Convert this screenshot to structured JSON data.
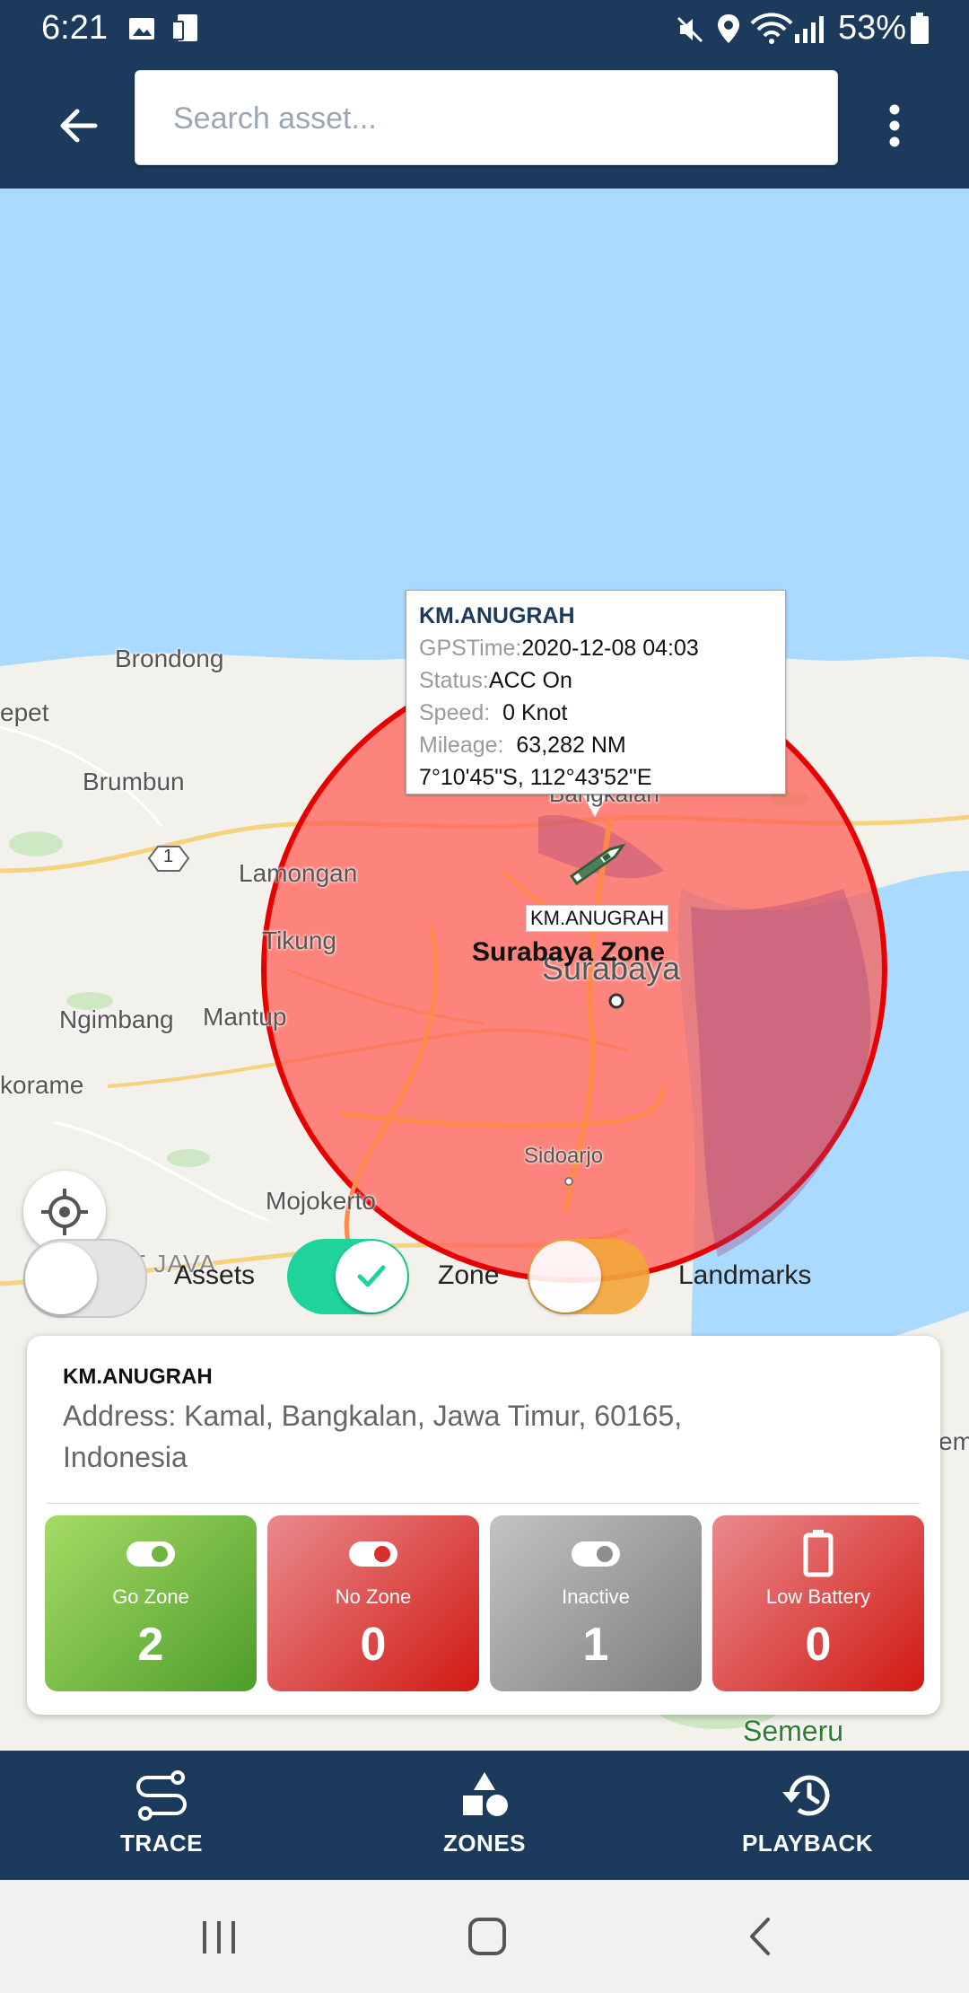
{
  "status_bar": {
    "time": "6:21",
    "battery": "53%"
  },
  "search": {
    "placeholder": "Search asset..."
  },
  "map": {
    "labels": {
      "brondong": "Brondong",
      "epet": "epet",
      "brumbun": "Brumbun",
      "lamongan": "Lamongan",
      "tikung": "Tikung",
      "ngimbang": "Ngimbang",
      "mantup": "Mantup",
      "korame": "korame",
      "bangkalan": "Bangkalan",
      "surabaya": "Surabaya",
      "sidoarjo": "Sidoarjo",
      "mojokerto": "Mojokerto",
      "east_java": "EAST JAVA",
      "semeru": "Semeru",
      "route_1": "1",
      "edge_em": "em"
    },
    "zone_name": "Surabaya Zone",
    "asset_label": "KM.ANUGRAH"
  },
  "popup": {
    "title": "KM.ANUGRAH",
    "gps_label": "GPSTime:",
    "gps_value": "2020-12-08 04:03",
    "status_label": "Status:",
    "status_value": "ACC On",
    "speed_label": "Speed:",
    "speed_value": "0 Knot",
    "mileage_label": "Mileage:",
    "mileage_value": "63,282 NM",
    "coords": "7°10'45\"S, 112°43'52\"E"
  },
  "toggles": {
    "assets": {
      "label": "Assets",
      "on": false
    },
    "zone": {
      "label": "Zone",
      "on": true
    },
    "landmarks": {
      "label": "Landmarks",
      "on": true
    }
  },
  "asset_card": {
    "name": "KM.ANUGRAH",
    "address": "Address: Kamal, Bangkalan, Jawa Timur, 60165, Indonesia"
  },
  "stats": [
    {
      "label": "Go Zone",
      "value": "2",
      "color": "#5fae3a"
    },
    {
      "label": "No Zone",
      "value": "0",
      "color": "#d9302a"
    },
    {
      "label": "Inactive",
      "value": "1",
      "color": "#8e8e8e"
    },
    {
      "label": "Low Battery",
      "value": "0",
      "color": "#d9302a"
    }
  ],
  "bottom_nav": [
    {
      "label": "TRACE",
      "icon": "route-icon"
    },
    {
      "label": "ZONES",
      "icon": "shapes-icon"
    },
    {
      "label": "PLAYBACK",
      "icon": "history-icon"
    }
  ],
  "colors": {
    "primary": "#1c3a5c",
    "zone_fill": "#ff5a50",
    "zone_stroke": "#e60000",
    "toggle_on_zone": "#1ed49a",
    "toggle_on_landmarks": "#f5a63a"
  }
}
